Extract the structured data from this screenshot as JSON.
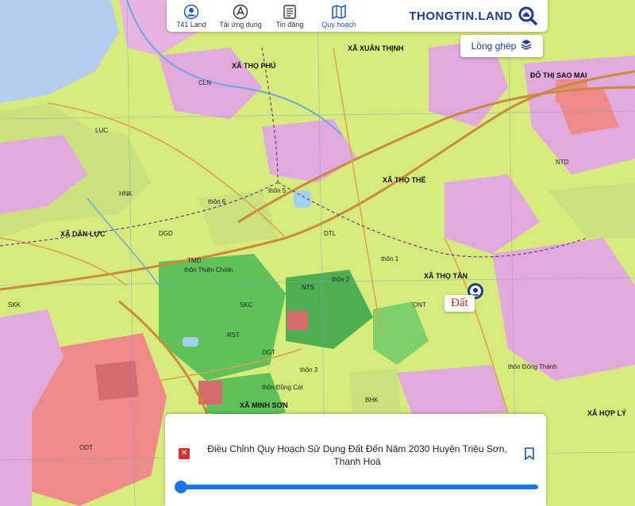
{
  "nav": {
    "items": [
      {
        "label": "741 Land",
        "icon": "user-icon",
        "active": false
      },
      {
        "label": "Tải ứng dụng",
        "icon": "app-download-icon",
        "active": false
      },
      {
        "label": "Tin đăng",
        "icon": "news-icon",
        "active": false
      },
      {
        "label": "Quy hoạch",
        "icon": "planning-map-icon",
        "active": true
      }
    ],
    "brand": "THONGTIN.LAND"
  },
  "layer_button": {
    "label": "Lồng ghép",
    "icon": "layers-icon"
  },
  "marker": {
    "label": "Đất",
    "icon": "location-pin-icon"
  },
  "info_panel": {
    "title": "Điều Chỉnh Quy Hoạch Sử Dụng Đất Đến Năm 2030 Huyện Triệu Sơn, Thanh Hoá",
    "close_icon": "close-icon",
    "bookmark_icon": "bookmark-icon",
    "opacity_slider_level": 0.0
  },
  "map_labels": {
    "communes": [
      "XÃ XUÂN THỊNH",
      "XÃ THỌ PHÚ",
      "XÃ THỌ THẾ",
      "XÃ DÂN LỰC",
      "XÃ THỌ TÂN",
      "XÃ MINH SƠN",
      "XÃ HỢP LÝ",
      "ĐÔ THỊ SAO MAI"
    ],
    "hamlets": [
      "thôn 1",
      "thôn 2",
      "thôn 3",
      "thôn 5",
      "thôn 6",
      "thôn Thiện Chính",
      "thôn Đông Thành",
      "thôn Đồng Cát"
    ],
    "land_codes": [
      "LUC",
      "ONT",
      "CLN",
      "HNK",
      "RST",
      "NTS",
      "DGT",
      "DTL",
      "BHK",
      "SKC",
      "TMD",
      "NTD",
      "ODT",
      "DGD",
      "SKK"
    ]
  },
  "colors": {
    "brand": "#1f3a93",
    "accent": "#1a73e8",
    "close": "#d32f2f",
    "marker_text": "#d21f1f",
    "rice_land": "#d7eb7c",
    "rural_residential": "#e7b3e0",
    "urban_residential": "#ee8a8a",
    "forest": "#5fc15a",
    "road": "#c98b3b",
    "water": "#9fd3ef"
  }
}
